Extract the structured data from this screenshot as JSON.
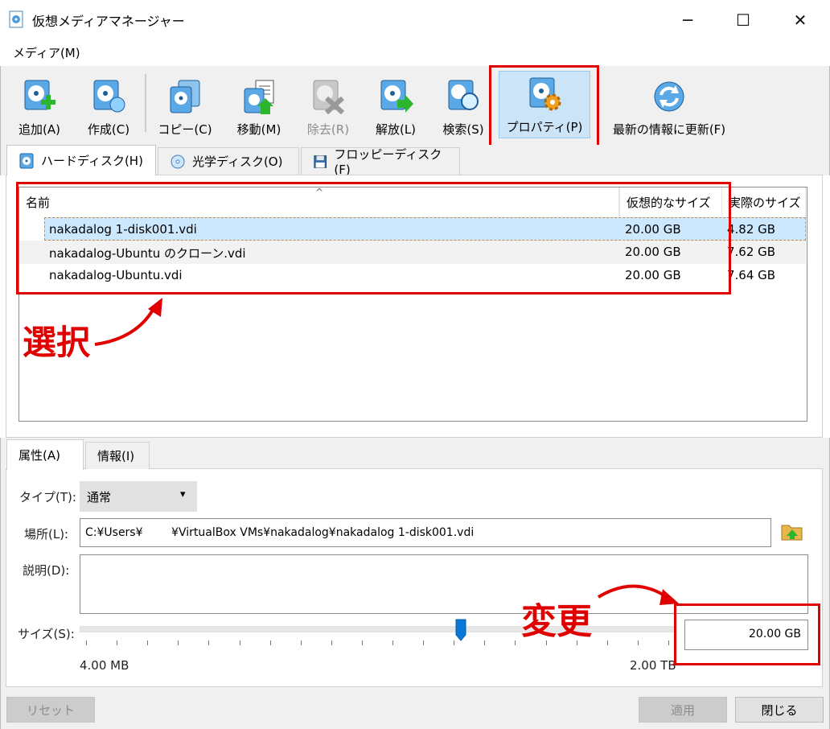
{
  "window": {
    "title": "仮想メディアマネージャー",
    "minimize": "─",
    "maximize": "☐",
    "close": "✕"
  },
  "menu": {
    "media": "メディア(M)"
  },
  "toolbar": {
    "add": "追加(A)",
    "create": "作成(C)",
    "copy": "コピー(C)",
    "move": "移動(M)",
    "remove": "除去(R)",
    "release": "解放(L)",
    "search": "検索(S)",
    "properties": "プロパティ(P)",
    "refresh": "最新の情報に更新(F)"
  },
  "tabs": {
    "hard_disk": "ハードディスク(H)",
    "optical": "光学ディスク(O)",
    "floppy": "フロッピーディスク(F)"
  },
  "table": {
    "sort_indicator": "^",
    "headers": {
      "name": "名前",
      "virtual_size": "仮想的なサイズ",
      "actual_size": "実際のサイズ"
    },
    "rows": [
      {
        "name": "nakadalog 1-disk001.vdi",
        "virtual_size": "20.00 GB",
        "actual_size": "4.82 GB"
      },
      {
        "name": "nakadalog-Ubuntu のクローン.vdi",
        "virtual_size": "20.00 GB",
        "actual_size": "7.62 GB"
      },
      {
        "name": "nakadalog-Ubuntu.vdi",
        "virtual_size": "20.00 GB",
        "actual_size": "7.64 GB"
      }
    ],
    "selected_index": 0
  },
  "annotations": {
    "select": "選択",
    "change": "変更"
  },
  "detail_tabs": {
    "attributes": "属性(A)",
    "info": "情報(I)"
  },
  "attributes": {
    "type_label": "タイプ(T):",
    "type_value": "通常",
    "dropdown_arrow": "▾",
    "location_label": "場所(L):",
    "location_value": "C:¥Users¥        ¥VirtualBox VMs¥nakadalog¥nakadalog 1-disk001.vdi",
    "description_label": "説明(D):",
    "description_value": "",
    "size_label": "サイズ(S):",
    "size_value": "20.00 GB",
    "size_min": "4.00 MB",
    "size_max": "2.00 TB",
    "slider_fraction": 0.64
  },
  "buttons": {
    "reset": "リセット",
    "apply": "適用",
    "close": "閉じる"
  },
  "colors": {
    "annotation_red": "#e00000",
    "selection": "#cce8ff",
    "toolbar_active": "#cce4f7"
  }
}
